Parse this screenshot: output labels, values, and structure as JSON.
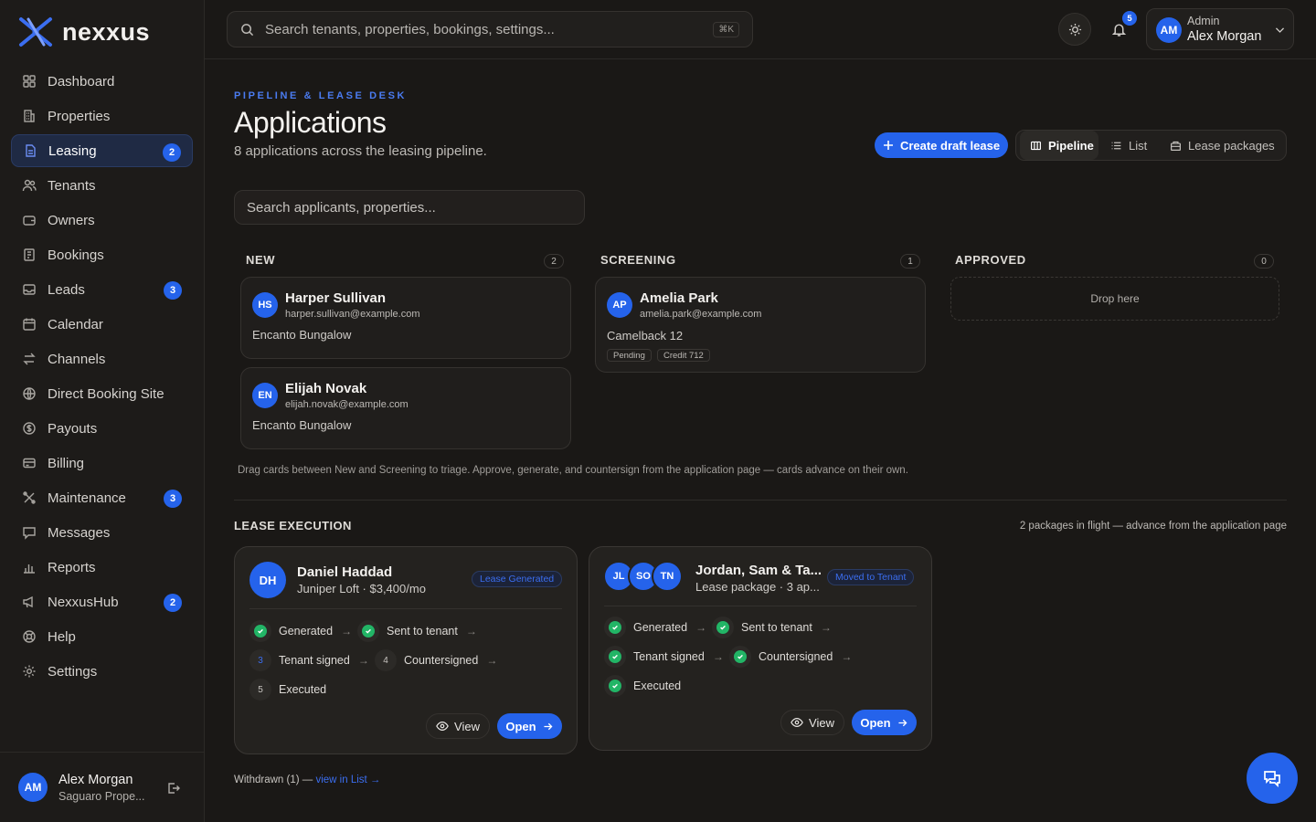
{
  "brand": {
    "name": "nexxus"
  },
  "nav": [
    {
      "label": "Dashboard",
      "icon": "dashboard-icon"
    },
    {
      "label": "Properties",
      "icon": "building-icon"
    },
    {
      "label": "Leasing",
      "icon": "document-icon",
      "badge": "2",
      "active": true
    },
    {
      "label": "Tenants",
      "icon": "users-icon"
    },
    {
      "label": "Owners",
      "icon": "wallet-icon"
    },
    {
      "label": "Bookings",
      "icon": "notebook-icon"
    },
    {
      "label": "Leads",
      "icon": "inbox-icon",
      "badge": "3"
    },
    {
      "label": "Calendar",
      "icon": "calendar-icon"
    },
    {
      "label": "Channels",
      "icon": "swap-icon"
    },
    {
      "label": "Direct Booking Site",
      "icon": "globe-icon"
    },
    {
      "label": "Payouts",
      "icon": "dollar-icon"
    },
    {
      "label": "Billing",
      "icon": "credit-card-icon"
    },
    {
      "label": "Maintenance",
      "icon": "wrench-icon",
      "badge": "3"
    },
    {
      "label": "Messages",
      "icon": "chat-icon"
    },
    {
      "label": "Reports",
      "icon": "bar-chart-icon"
    },
    {
      "label": "NexxusHub",
      "icon": "megaphone-icon",
      "badge": "2"
    },
    {
      "label": "Help",
      "icon": "lifebuoy-icon"
    },
    {
      "label": "Settings",
      "icon": "gear-icon"
    }
  ],
  "sidebar_user": {
    "initials": "AM",
    "name": "Alex Morgan",
    "org": "Saguaro Prope..."
  },
  "topbar": {
    "search_placeholder": "Search tenants, properties, bookings, settings...",
    "shortcut": "⌘K",
    "notification_count": "5",
    "user_role": "Admin",
    "user_name": "Alex Morgan",
    "user_initials": "AM"
  },
  "page": {
    "eyebrow": "PIPELINE & LEASE DESK",
    "title": "Applications",
    "subtitle": "8 applications across the leasing pipeline.",
    "create_label": "Create draft lease",
    "views": [
      "Pipeline",
      "List",
      "Lease packages"
    ],
    "search_placeholder": "Search applicants, properties..."
  },
  "columns": [
    {
      "title": "NEW",
      "count": "2",
      "cards": [
        {
          "initials": "HS",
          "name": "Harper Sullivan",
          "email": "harper.sullivan@example.com",
          "property": "Encanto Bungalow",
          "tags": []
        },
        {
          "initials": "EN",
          "name": "Elijah Novak",
          "email": "elijah.novak@example.com",
          "property": "Encanto Bungalow",
          "tags": []
        }
      ]
    },
    {
      "title": "SCREENING",
      "count": "1",
      "cards": [
        {
          "initials": "AP",
          "name": "Amelia Park",
          "email": "amelia.park@example.com",
          "property": "Camelback 12",
          "tags": [
            "Pending",
            "Credit 712"
          ]
        }
      ]
    },
    {
      "title": "APPROVED",
      "count": "0",
      "cards": [],
      "empty": "Drop here"
    }
  ],
  "pipeline_note": "Drag cards between New and Screening to triage. Approve, generate, and countersign from the application page — cards advance on their own.",
  "lease_exec": {
    "title": "LEASE EXECUTION",
    "summary": "2 packages in flight — advance from the application page",
    "cards": [
      {
        "initials": "DH",
        "name": "Daniel Haddad",
        "sub": "Juniper Loft · $3,400/mo",
        "status": "Lease Generated",
        "steps": [
          {
            "label": "Generated",
            "state": "done"
          },
          {
            "label": "Sent to tenant",
            "state": "done"
          },
          {
            "label": "Tenant signed",
            "state": "current",
            "num": "3"
          },
          {
            "label": "Countersigned",
            "state": "todo",
            "num": "4"
          },
          {
            "label": "Executed",
            "state": "todo",
            "num": "5"
          }
        ]
      },
      {
        "avatars": [
          "JL",
          "SO",
          "TN"
        ],
        "name": "Jordan, Sam & Ta...",
        "sub": "Lease package · 3 ap...",
        "status": "Moved to Tenant",
        "steps": [
          {
            "label": "Generated",
            "state": "done"
          },
          {
            "label": "Sent to tenant",
            "state": "done"
          },
          {
            "label": "Tenant signed",
            "state": "done"
          },
          {
            "label": "Countersigned",
            "state": "done"
          },
          {
            "label": "Executed",
            "state": "done"
          }
        ]
      }
    ],
    "view_label": "View",
    "open_label": "Open"
  },
  "withdrawn": {
    "text": "Withdrawn (1) —",
    "link": "view in List →"
  },
  "colors": {
    "accent": "#2563eb",
    "success": "#22b566",
    "bg": "#1a1816"
  }
}
